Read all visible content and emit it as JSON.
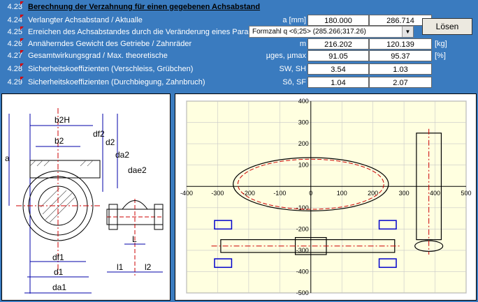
{
  "rows": [
    {
      "num": "4.23",
      "label": "Berechnung der Verzahnung für einen gegebenen Achsabstand",
      "unit": "",
      "v1": "",
      "v2": "",
      "u2": ""
    },
    {
      "num": "4.24",
      "label": "Verlangter Achsabstand / Aktualle",
      "unit": "a [mm]",
      "v1": "180.000",
      "v2": "286.714",
      "u2": ""
    },
    {
      "num": "4.25",
      "label": "Erreichen des Achsabstandes durch die Veränderung eines Parame",
      "unit": "",
      "v1": "",
      "v2": "",
      "u2": ""
    },
    {
      "num": "4.26",
      "label": "Annäherndes Gewicht des Getriebe / Zahnräder",
      "unit": "m",
      "v1": "216.202",
      "v2": "120.139",
      "u2": "[kg]"
    },
    {
      "num": "4.27",
      "label": "Gesamtwirkungsgrad / Max. theoretische",
      "unit": "µges, µmax",
      "v1": "91.05",
      "v2": "95.37",
      "u2": "[%]"
    },
    {
      "num": "4.28",
      "label": "Sicherheitskoeffizienten (Verschleiss, Grübchen)",
      "unit": "SW, SH",
      "v1": "3.54",
      "v2": "1.03",
      "u2": ""
    },
    {
      "num": "4.29",
      "label": "Sicherheitskoeffizienten (Durchbiegung, Zahnbruch)",
      "unit": "Sô, SF",
      "v1": "1.04",
      "v2": "2.07",
      "u2": ""
    }
  ],
  "dropdown": {
    "selected": "Formzahl q <6;25>  (285.266;317.26)"
  },
  "solve_button": "Lösen",
  "diagram": {
    "labels": {
      "b2H": "b2H",
      "b2": "b2",
      "df2": "df2",
      "d2": "d2",
      "da2": "da2",
      "dae2": "dae2",
      "a": "a",
      "df1": "df1",
      "d1": "d1",
      "da1": "da1",
      "L": "L",
      "l1": "l1",
      "l2": "l2"
    }
  },
  "chart_data": {
    "type": "scatter",
    "title": "",
    "xlabel": "",
    "ylabel": "",
    "xlim": [
      -400,
      500
    ],
    "ylim": [
      -500,
      400
    ],
    "xticks": [
      -400,
      -300,
      -200,
      -100,
      0,
      100,
      200,
      300,
      400,
      500
    ],
    "yticks": [
      400,
      300,
      200,
      100,
      -100,
      -200,
      -300,
      -400,
      -500
    ],
    "grid": true,
    "colors": {
      "background": "#ffffe0",
      "grid": "#c8c8c8",
      "outline": "#000000",
      "centerline": "#cc0000",
      "bearing": "#0000cc"
    }
  }
}
